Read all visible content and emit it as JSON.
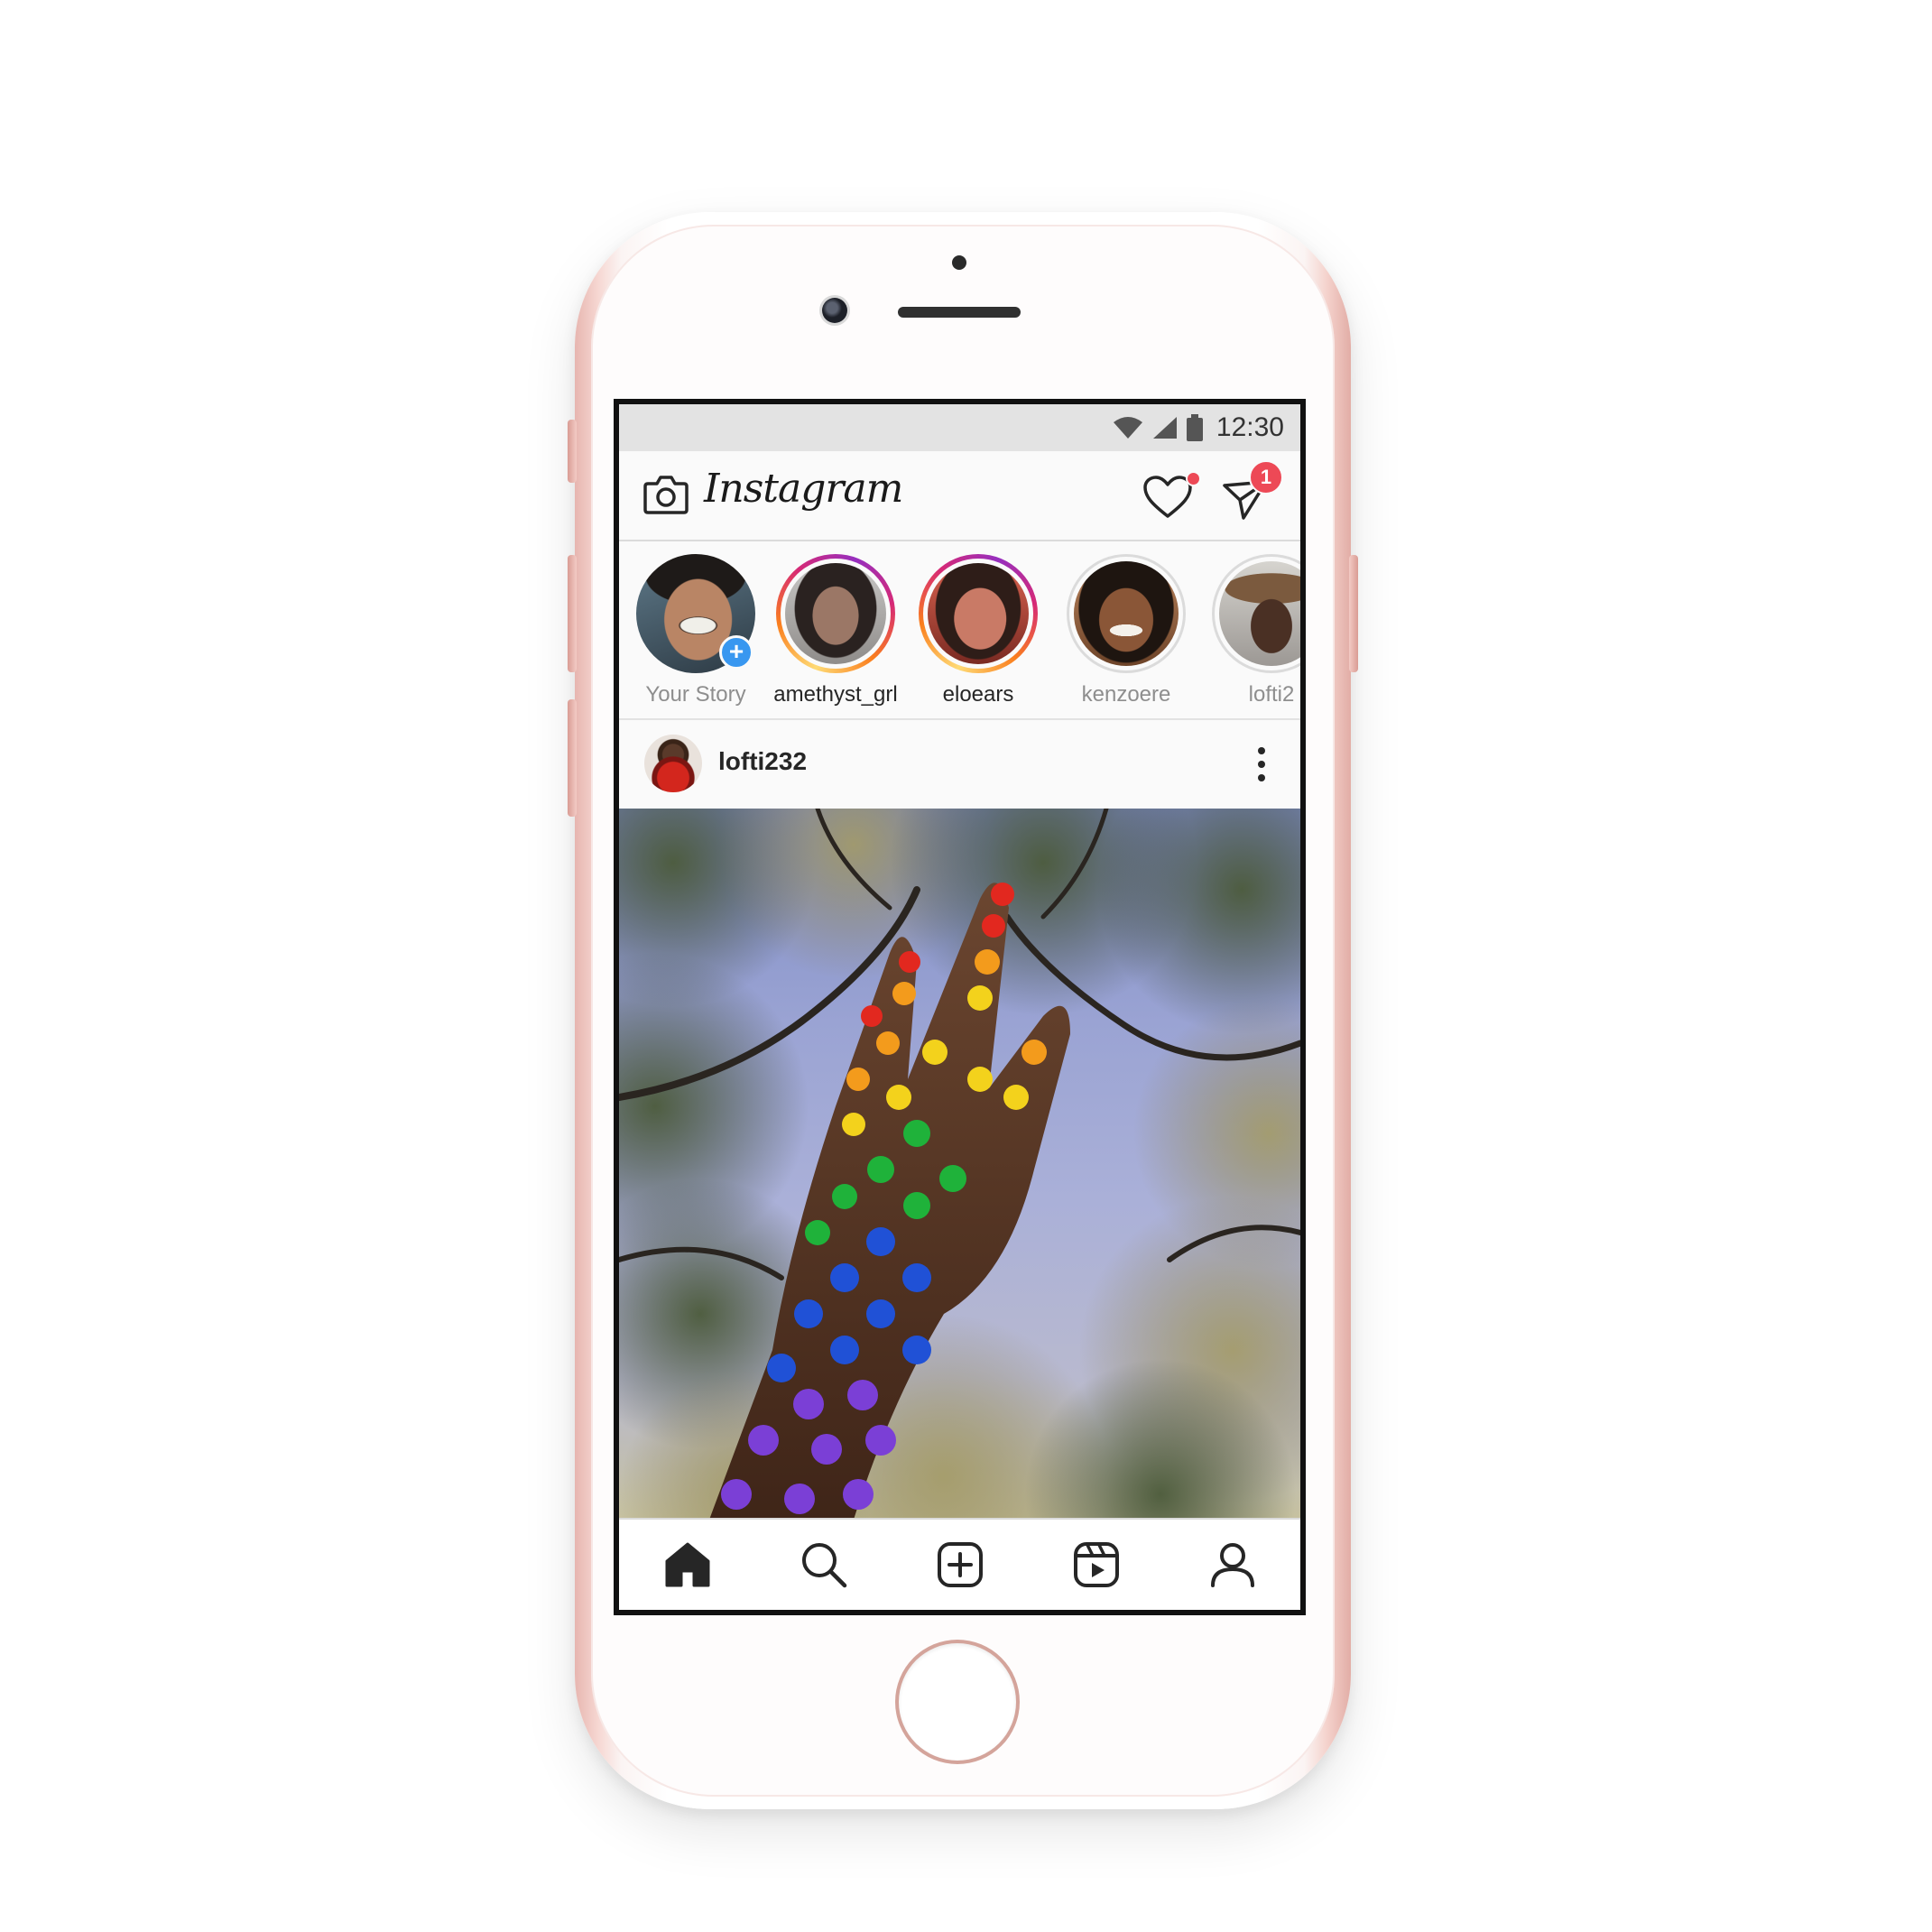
{
  "status_bar": {
    "time": "12:30",
    "icons": [
      "wifi-icon",
      "cellular-signal-icon",
      "battery-icon"
    ]
  },
  "header": {
    "app_name": "Instagram",
    "camera_icon": "camera-icon",
    "activity_icon": "heart-icon",
    "activity_has_notification": true,
    "direct_icon": "paper-plane-icon",
    "direct_badge_count": "1"
  },
  "stories": [
    {
      "label": "Your Story",
      "state": "own",
      "add_badge": "+"
    },
    {
      "label": "amethyst_grl",
      "state": "unseen"
    },
    {
      "label": "eloears",
      "state": "unseen"
    },
    {
      "label": "kenzoere",
      "state": "seen"
    },
    {
      "label": "lofti2",
      "state": "seen"
    }
  ],
  "post": {
    "username": "lofti232",
    "more_icon": "more-vertical-icon"
  },
  "bottom_nav": [
    {
      "name": "home",
      "icon": "home-icon",
      "active": true
    },
    {
      "name": "search",
      "icon": "search-icon",
      "active": false
    },
    {
      "name": "create",
      "icon": "add-post-icon",
      "active": false
    },
    {
      "name": "reels",
      "icon": "reels-icon",
      "active": false
    },
    {
      "name": "profile",
      "icon": "profile-icon",
      "active": false
    }
  ],
  "colors": {
    "phone_body": "#f4d1cb",
    "notification_red": "#ed4956",
    "story_add_blue": "#3897f0",
    "text_primary": "#262626",
    "text_muted": "#8e8e8e"
  }
}
